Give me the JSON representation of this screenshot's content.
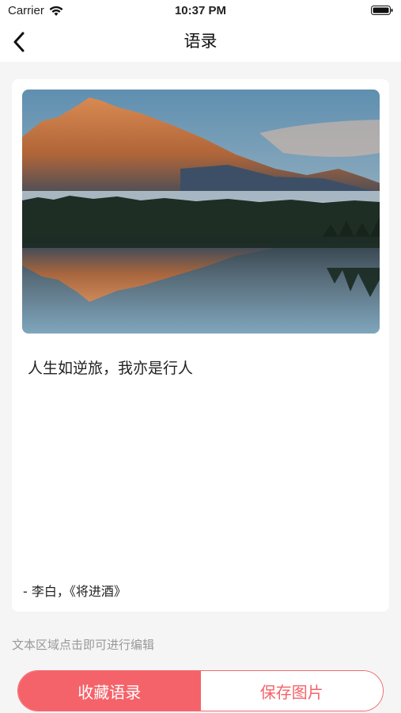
{
  "status_bar": {
    "carrier": "Carrier",
    "time": "10:37 PM"
  },
  "nav": {
    "title": "语录",
    "back_icon": "chevron-left-icon"
  },
  "card": {
    "quote": "人生如逆旅，我亦是行人",
    "author": "- 李白，《将进酒》"
  },
  "hint": "文本区域点击即可进行编辑",
  "actions": {
    "favorite_label": "收藏语录",
    "save_label": "保存图片"
  },
  "colors": {
    "accent": "#f5636a",
    "background": "#f5f5f5",
    "card": "#ffffff"
  }
}
